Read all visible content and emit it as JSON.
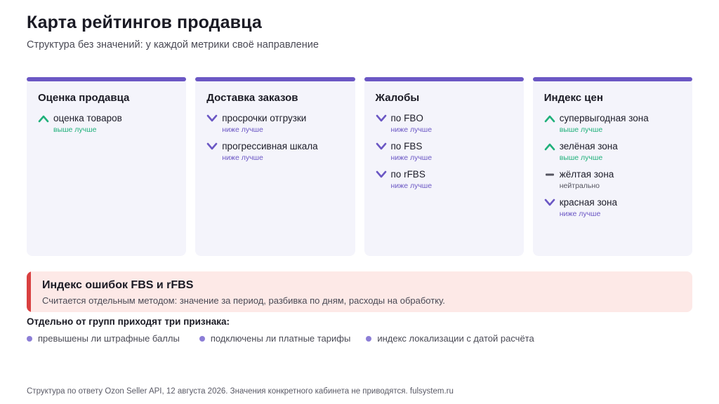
{
  "header": {
    "title": "Карта рейтингов продавца",
    "subtitle": "Структура без значений: у каждой метрики своё направление"
  },
  "colors": {
    "accent": "#6b57c4",
    "up": "#1fb07a",
    "down": "#6b57c4",
    "neutral": "#555560",
    "error_stripe": "#d94040",
    "error_bg": "#fde9e7",
    "bullet": "#8c7ed6"
  },
  "groups": [
    {
      "title": "Оценка продавца",
      "metrics": [
        {
          "name": "оценка товаров",
          "direction": "выше лучше",
          "icon": "chevron-up-icon",
          "trend": "up"
        }
      ]
    },
    {
      "title": "Доставка заказов",
      "metrics": [
        {
          "name": "просрочки отгрузки",
          "direction": "ниже лучше",
          "icon": "chevron-down-icon",
          "trend": "down"
        },
        {
          "name": "прогрессивная шкала",
          "direction": "ниже лучше",
          "icon": "chevron-down-icon",
          "trend": "down"
        }
      ]
    },
    {
      "title": "Жалобы",
      "metrics": [
        {
          "name": "по FBO",
          "direction": "ниже лучше",
          "icon": "chevron-down-icon",
          "trend": "down"
        },
        {
          "name": "по FBS",
          "direction": "ниже лучше",
          "icon": "chevron-down-icon",
          "trend": "down"
        },
        {
          "name": "по rFBS",
          "direction": "ниже лучше",
          "icon": "chevron-down-icon",
          "trend": "down"
        }
      ]
    },
    {
      "title": "Индекс цен",
      "metrics": [
        {
          "name": "супервыгодная зона",
          "direction": "выше лучше",
          "icon": "chevron-up-icon",
          "trend": "up"
        },
        {
          "name": "зелёная зона",
          "direction": "выше лучше",
          "icon": "chevron-up-icon",
          "trend": "up"
        },
        {
          "name": "жёлтая зона",
          "direction": "нейтрально",
          "icon": "dash-icon",
          "trend": "neutral"
        },
        {
          "name": "красная зона",
          "direction": "ниже лучше",
          "icon": "chevron-down-icon",
          "trend": "down"
        }
      ]
    }
  ],
  "error_index": {
    "title": "Индекс ошибок FBS и rFBS",
    "description": "Считается отдельным методом: значение за период, разбивка по дням, расходы на обработку."
  },
  "signs": {
    "heading": "Отдельно от групп приходят три признака:",
    "items": [
      "превышены ли штрафные баллы",
      "подключены ли платные тарифы",
      "индекс локализации с датой расчёта"
    ]
  },
  "footer": "Структура по ответу Ozon Seller API, 12 августа 2026. Значения конкретного кабинета не приводятся. fulsystem.ru"
}
